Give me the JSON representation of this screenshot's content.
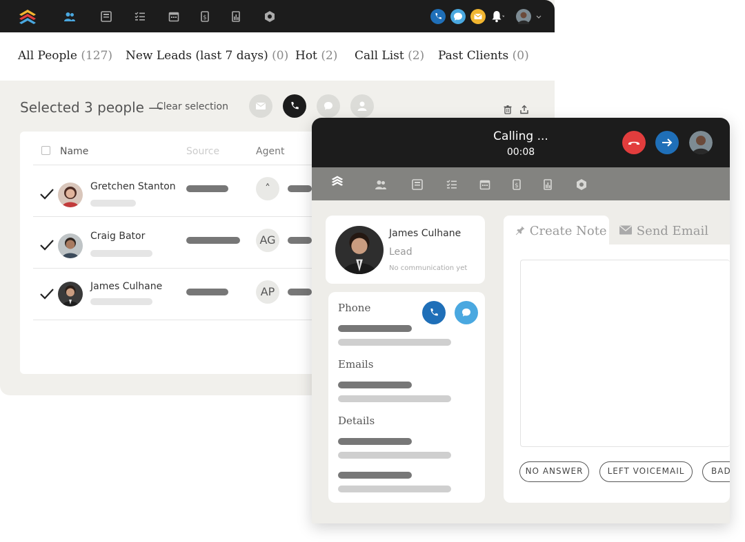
{
  "colors": {
    "dark_bar": "#1c1c1c",
    "call_red": "#e23d3d",
    "call_blue": "#1f6fb8",
    "chat_blue": "#4aa8e0",
    "mail_yellow": "#f2b630",
    "nav_grey": "#838380"
  },
  "topbar": {
    "nav_icons": [
      "people-icon",
      "inbox-icon",
      "tasks-icon",
      "calendar-icon",
      "deals-icon",
      "reports-icon",
      "settings-icon"
    ],
    "right_icons": [
      "phone-icon",
      "chat-icon",
      "email-icon",
      "bell-icon",
      "user-avatar"
    ]
  },
  "tabs": [
    {
      "label": "All People",
      "count": "(127)"
    },
    {
      "label": "New Leads (last 7 days)",
      "count": "(0)"
    },
    {
      "label": "Hot",
      "count": "(2)"
    },
    {
      "label": "Call List",
      "count": "(2)"
    },
    {
      "label": "Past Clients",
      "count": "(0)"
    }
  ],
  "selection": {
    "label": "Selected 3 people —",
    "clear": "Clear selection"
  },
  "table": {
    "headers": {
      "name": "Name",
      "source": "Source",
      "agent": "Agent"
    },
    "rows": [
      {
        "name": "Gretchen Stanton",
        "agent": "˄",
        "checked": true
      },
      {
        "name": "Craig Bator",
        "agent": "AG",
        "checked": true
      },
      {
        "name": "James Culhane",
        "agent": "AP",
        "checked": true
      }
    ]
  },
  "call": {
    "status": "Calling ...",
    "timer": "00:08"
  },
  "contact": {
    "name": "James Culhane",
    "role": "Lead",
    "status": "No communication yet"
  },
  "details": {
    "phone_label": "Phone",
    "emails_label": "Emails",
    "details_label": "Details"
  },
  "note_tabs": {
    "create": "Create Note",
    "send": "Send Email"
  },
  "outcomes": [
    "NO ANSWER",
    "LEFT VOICEMAIL",
    "BAD"
  ]
}
